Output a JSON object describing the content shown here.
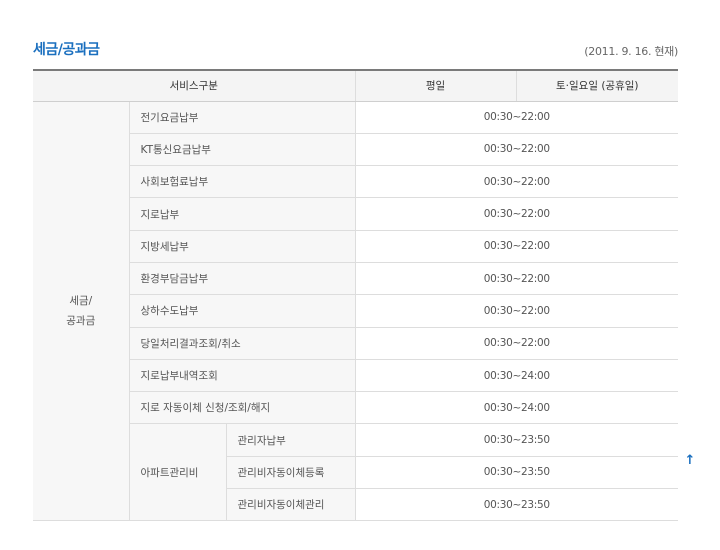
{
  "header": {
    "title": "세금/공과금",
    "as_of": "(2011. 9. 16. 현재)"
  },
  "table": {
    "columns": {
      "service": "서비스구분",
      "weekday": "평일",
      "weekend": "토·일요일 (공휴일)"
    },
    "category": {
      "line1": "세금/",
      "line2": "공과금"
    },
    "rows": [
      {
        "name": "전기요금납부",
        "time": "00:30~22:00"
      },
      {
        "name": "KT통신요금납부",
        "time": "00:30~22:00"
      },
      {
        "name": "사회보험료납부",
        "time": "00:30~22:00"
      },
      {
        "name": "지로납부",
        "time": "00:30~22:00"
      },
      {
        "name": "지방세납부",
        "time": "00:30~22:00"
      },
      {
        "name": "환경부담금납부",
        "time": "00:30~22:00"
      },
      {
        "name": "상하수도납부",
        "time": "00:30~22:00"
      },
      {
        "name": "당일처리결과조회/취소",
        "time": "00:30~22:00"
      },
      {
        "name": "지로납부내역조회",
        "time": "00:30~24:00"
      },
      {
        "name": "지로 자동이체 신청/조회/해지",
        "time": "00:30~24:00"
      }
    ],
    "apartment": {
      "name": "아파트관리비",
      "rows": [
        {
          "name": "관리자납부",
          "time": "00:30~23:50"
        },
        {
          "name": "관리비자동이체등록",
          "time": "00:30~23:50"
        },
        {
          "name": "관리비자동이체관리",
          "time": "00:30~23:50"
        }
      ]
    }
  },
  "top_button": {
    "icon": "arrow-up-icon",
    "glyph": "↑"
  }
}
